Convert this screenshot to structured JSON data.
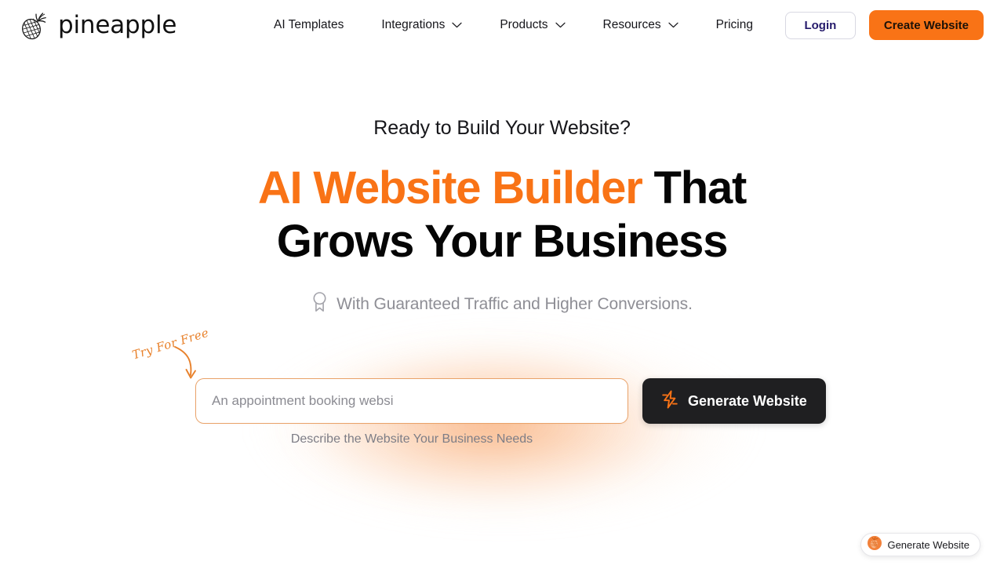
{
  "brand": {
    "name": "pineapple",
    "logo_icon": "pineapple-icon"
  },
  "nav": {
    "items": [
      {
        "label": "AI Templates",
        "has_dropdown": false
      },
      {
        "label": "Integrations",
        "has_dropdown": true
      },
      {
        "label": "Products",
        "has_dropdown": true
      },
      {
        "label": "Resources",
        "has_dropdown": true
      },
      {
        "label": "Pricing",
        "has_dropdown": false
      }
    ]
  },
  "header_actions": {
    "login_label": "Login",
    "create_label": "Create Website"
  },
  "hero": {
    "eyebrow": "Ready to Build Your Website?",
    "headline_accent": "AI Website Builder",
    "headline_rest": " That",
    "headline_line2": "Grows Your Business",
    "subtitle": "With Guaranteed Traffic and Higher Conversions.",
    "subtitle_icon": "award-badge-icon"
  },
  "search": {
    "input_value": "An appointment booking websi",
    "input_placeholder": "An appointment booking websi",
    "generate_label": "Generate Website",
    "generate_icon": "lightning-bolt-icon",
    "helper_text": "Describe the Website Your Business Needs"
  },
  "annotation": {
    "try_free_label": "Try For Free",
    "arrow_icon": "curved-arrow-down-icon"
  },
  "float_widget": {
    "label": "Generate Website",
    "icon": "pineapple-badge-icon"
  },
  "colors": {
    "accent_orange": "#f97316",
    "annotation_orange": "#e8812b",
    "dark_button": "#1f1f21",
    "login_text": "#251a6b",
    "muted_text": "#8e8e95"
  }
}
